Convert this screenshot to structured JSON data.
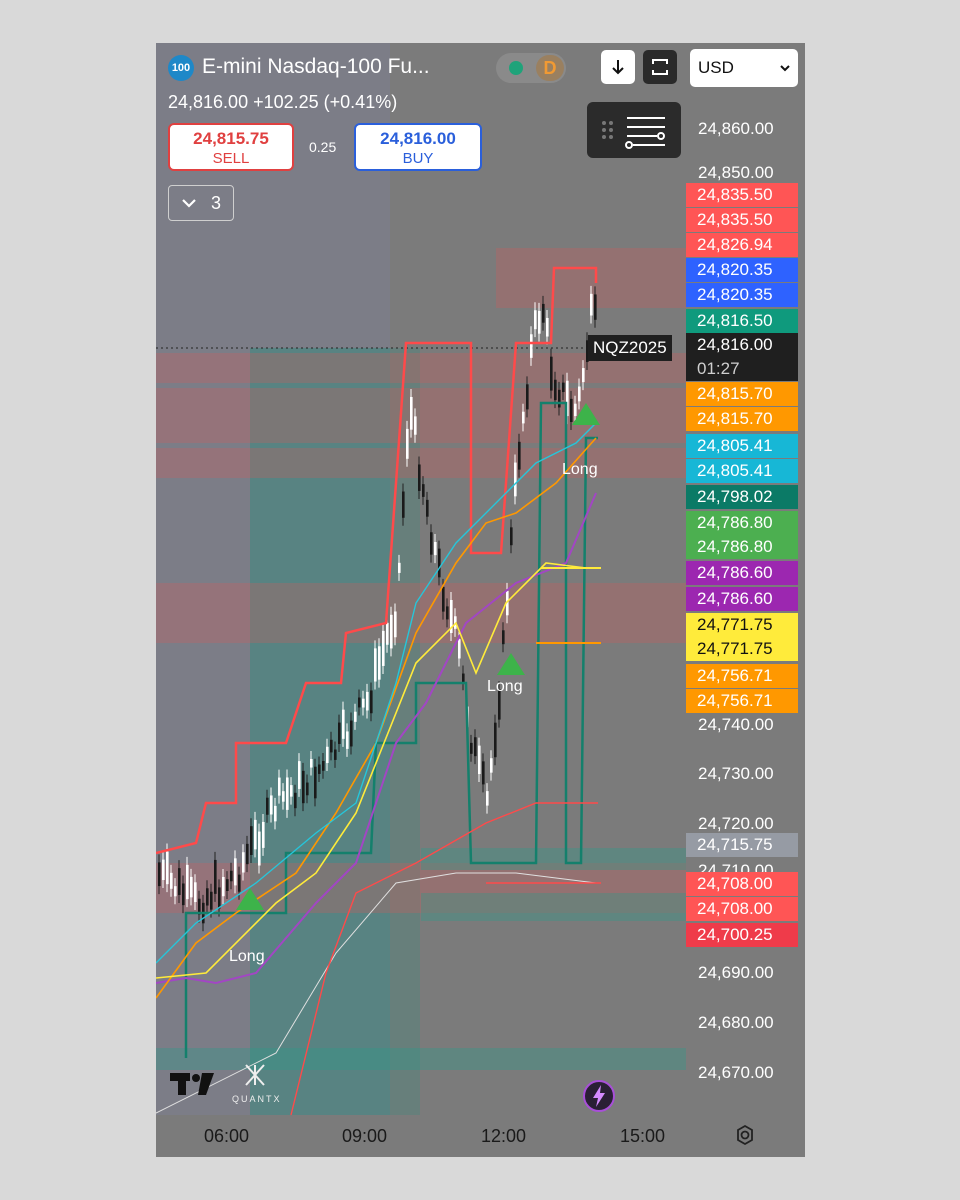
{
  "header": {
    "symbol_badge": "100",
    "symbol_title": "E-mini Nasdaq-100 Fu...",
    "interval_badge": "D",
    "last_price": "24,816.00",
    "change": "+102.25 (+0.41%)",
    "currency": "USD"
  },
  "trade": {
    "sell_price": "24,815.75",
    "sell_label": "SELL",
    "spread": "0.25",
    "buy_price": "24,816.00",
    "buy_label": "BUY"
  },
  "indicators": {
    "collapsed_count": "3"
  },
  "price_axis": {
    "ticks": [
      "24,860.00",
      "24,850.00",
      "24,740.00",
      "24,730.00",
      "24,720.00",
      "24,710.00",
      "24,690.00",
      "24,680.00",
      "24,670.00"
    ]
  },
  "price_tags": [
    {
      "value": "24,835.50",
      "color": "#ff5555"
    },
    {
      "value": "24,835.50",
      "color": "#ff5555"
    },
    {
      "value": "24,826.94",
      "color": "#ff5555"
    },
    {
      "value": "24,820.35",
      "color": "#2e62ff"
    },
    {
      "value": "24,820.35",
      "color": "#2e62ff"
    },
    {
      "value": "24,816.50",
      "color": "#0f9a7d"
    },
    {
      "value": "24,815.70",
      "color": "#ff9800"
    },
    {
      "value": "24,815.70",
      "color": "#ff9800"
    },
    {
      "value": "24,805.41",
      "color": "#17b7d6"
    },
    {
      "value": "24,805.41",
      "color": "#17b7d6"
    },
    {
      "value": "24,798.02",
      "color": "#0b7a66"
    },
    {
      "value": "24,786.80",
      "color": "#4caf50"
    },
    {
      "value": "24,786.80",
      "color": "#4caf50"
    },
    {
      "value": "24,786.60",
      "color": "#9c27b0"
    },
    {
      "value": "24,786.60",
      "color": "#9c27b0"
    },
    {
      "value": "24,771.75",
      "color": "#ffeb3b"
    },
    {
      "value": "24,771.75",
      "color": "#ffeb3b"
    },
    {
      "value": "24,756.71",
      "color": "#ff9800"
    },
    {
      "value": "24,756.71",
      "color": "#ff9800"
    },
    {
      "value": "24,715.75",
      "color": "#9ba1ab"
    },
    {
      "value": "24,708.00",
      "color": "#ff5555"
    },
    {
      "value": "24,708.00",
      "color": "#ff5555"
    },
    {
      "value": "24,700.25",
      "color": "#ef3b4a"
    }
  ],
  "current_price_tag": {
    "price": "24,816.00",
    "countdown": "01:27",
    "symbol": "NQZ2025"
  },
  "signals": [
    {
      "label": "Long"
    },
    {
      "label": "Long"
    },
    {
      "label": "Long"
    }
  ],
  "time_axis": {
    "labels": [
      "06:00",
      "09:00",
      "12:00",
      "15:00"
    ]
  },
  "branding": {
    "quantx": "QUANTX"
  },
  "colors": {
    "sell": "#e04040",
    "buy": "#2a5fdb",
    "background": "#7b7b7b"
  }
}
